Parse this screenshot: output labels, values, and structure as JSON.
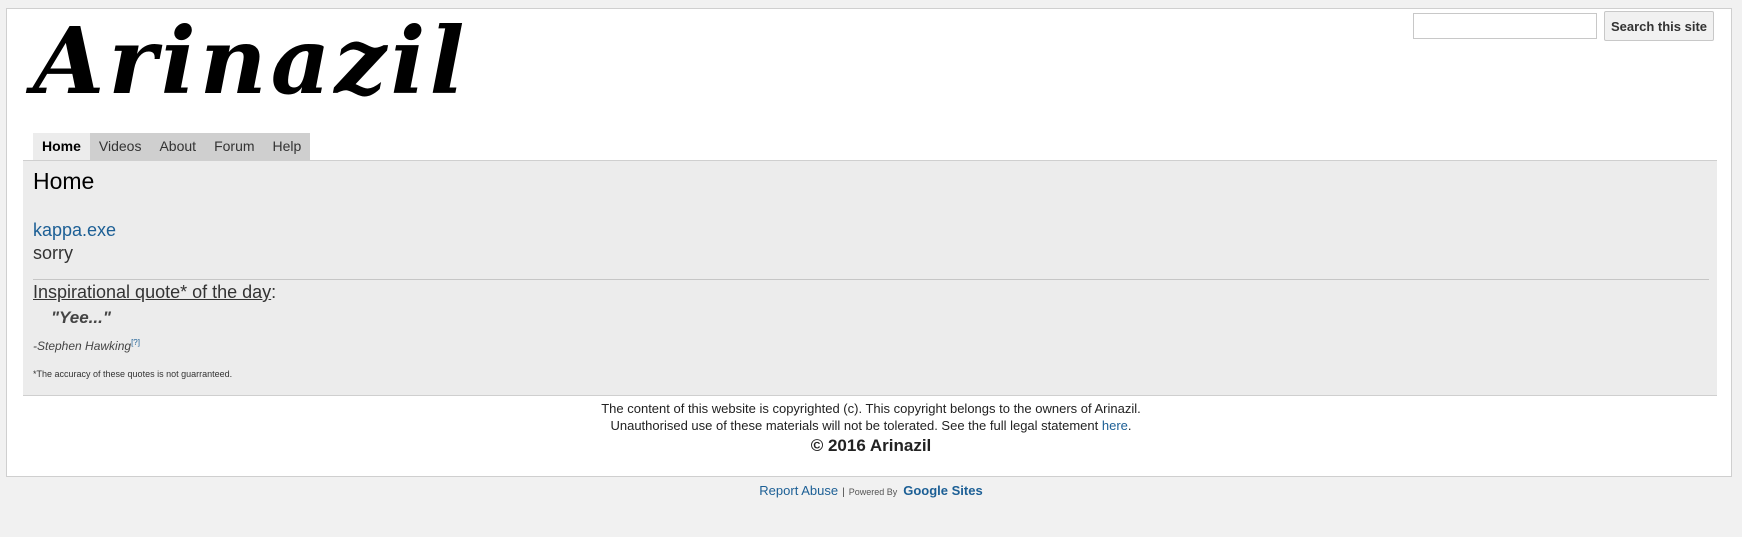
{
  "header": {
    "logo_text": "Arinazil",
    "search": {
      "value": "",
      "placeholder": "",
      "button_label": "Search this site"
    }
  },
  "nav": {
    "items": [
      {
        "label": "Home",
        "active": true
      },
      {
        "label": "Videos",
        "active": false
      },
      {
        "label": "About",
        "active": false
      },
      {
        "label": "Forum",
        "active": false
      },
      {
        "label": "Help",
        "active": false
      }
    ]
  },
  "content": {
    "page_title": "Home",
    "link_text": "kappa.exe",
    "sorry_text": "sorry",
    "quote_heading": "Inspirational quote* of the day",
    "quote_heading_suffix": ":",
    "quote_text": "\"Yee...\"",
    "quote_author": "-Stephen Hawking",
    "quote_ref": "[?]",
    "disclaimer": "*The accuracy of these quotes is not guarranteed."
  },
  "footer": {
    "line1": "The content of this website is copyrighted (c). This copyright belongs to the owners of Arinazil.",
    "line2_prefix": "Unauthorised use of these materials will not be tolerated. See the full legal statement ",
    "line2_link": "here",
    "line2_suffix": ".",
    "copyright": "© 2016 Arinazil"
  },
  "bottom_bar": {
    "report_abuse": "Report Abuse",
    "separator": "|",
    "powered_by": "Powered By",
    "google_sites": "Google Sites"
  },
  "colors": {
    "link": "#1c5f95",
    "content_bg": "#ececec",
    "nav_bg": "#cfcfcf"
  }
}
